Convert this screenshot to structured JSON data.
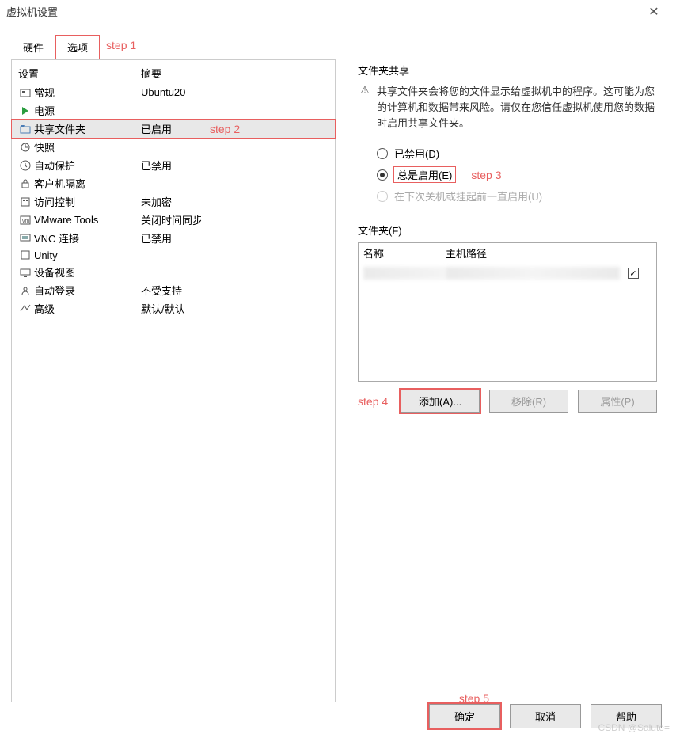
{
  "window": {
    "title": "虚拟机设置"
  },
  "tabs": {
    "hardware": "硬件",
    "options": "选项"
  },
  "steps": {
    "s1": "step 1",
    "s2": "step 2",
    "s3": "step 3",
    "s4": "step 4",
    "s5": "step 5"
  },
  "table": {
    "headers": {
      "name": "设置",
      "summary": "摘要"
    },
    "rows": [
      {
        "name": "常规",
        "summary": "Ubuntu20",
        "icon": "general"
      },
      {
        "name": "电源",
        "summary": "",
        "icon": "power"
      },
      {
        "name": "共享文件夹",
        "summary": "已启用",
        "icon": "folder",
        "highlight": true
      },
      {
        "name": "快照",
        "summary": "",
        "icon": "snapshot"
      },
      {
        "name": "自动保护",
        "summary": "已禁用",
        "icon": "clock"
      },
      {
        "name": "客户机隔离",
        "summary": "",
        "icon": "lock"
      },
      {
        "name": "访问控制",
        "summary": "未加密",
        "icon": "access"
      },
      {
        "name": "VMware Tools",
        "summary": "关闭时间同步",
        "icon": "vm"
      },
      {
        "name": "VNC 连接",
        "summary": "已禁用",
        "icon": "vnc"
      },
      {
        "name": "Unity",
        "summary": "",
        "icon": "unity"
      },
      {
        "name": "设备视图",
        "summary": "",
        "icon": "device"
      },
      {
        "name": "自动登录",
        "summary": "不受支持",
        "icon": "login"
      },
      {
        "name": "高级",
        "summary": "默认/默认",
        "icon": "advanced"
      }
    ]
  },
  "share": {
    "title": "文件夹共享",
    "warning": "共享文件夹会将您的文件显示给虚拟机中的程序。这可能为您的计算机和数据带来风险。请仅在您信任虚拟机使用您的数据时启用共享文件夹。",
    "radios": {
      "disabled": "已禁用(D)",
      "always": "总是启用(E)",
      "until": "在下次关机或挂起前一直启用(U)"
    }
  },
  "folders": {
    "title": "文件夹(F)",
    "headers": {
      "name": "名称",
      "path": "主机路径"
    },
    "buttons": {
      "add": "添加(A)...",
      "remove": "移除(R)",
      "props": "属性(P)"
    }
  },
  "footer": {
    "ok": "确定",
    "cancel": "取消",
    "help": "帮助"
  },
  "watermark": "CSDN @Salute="
}
